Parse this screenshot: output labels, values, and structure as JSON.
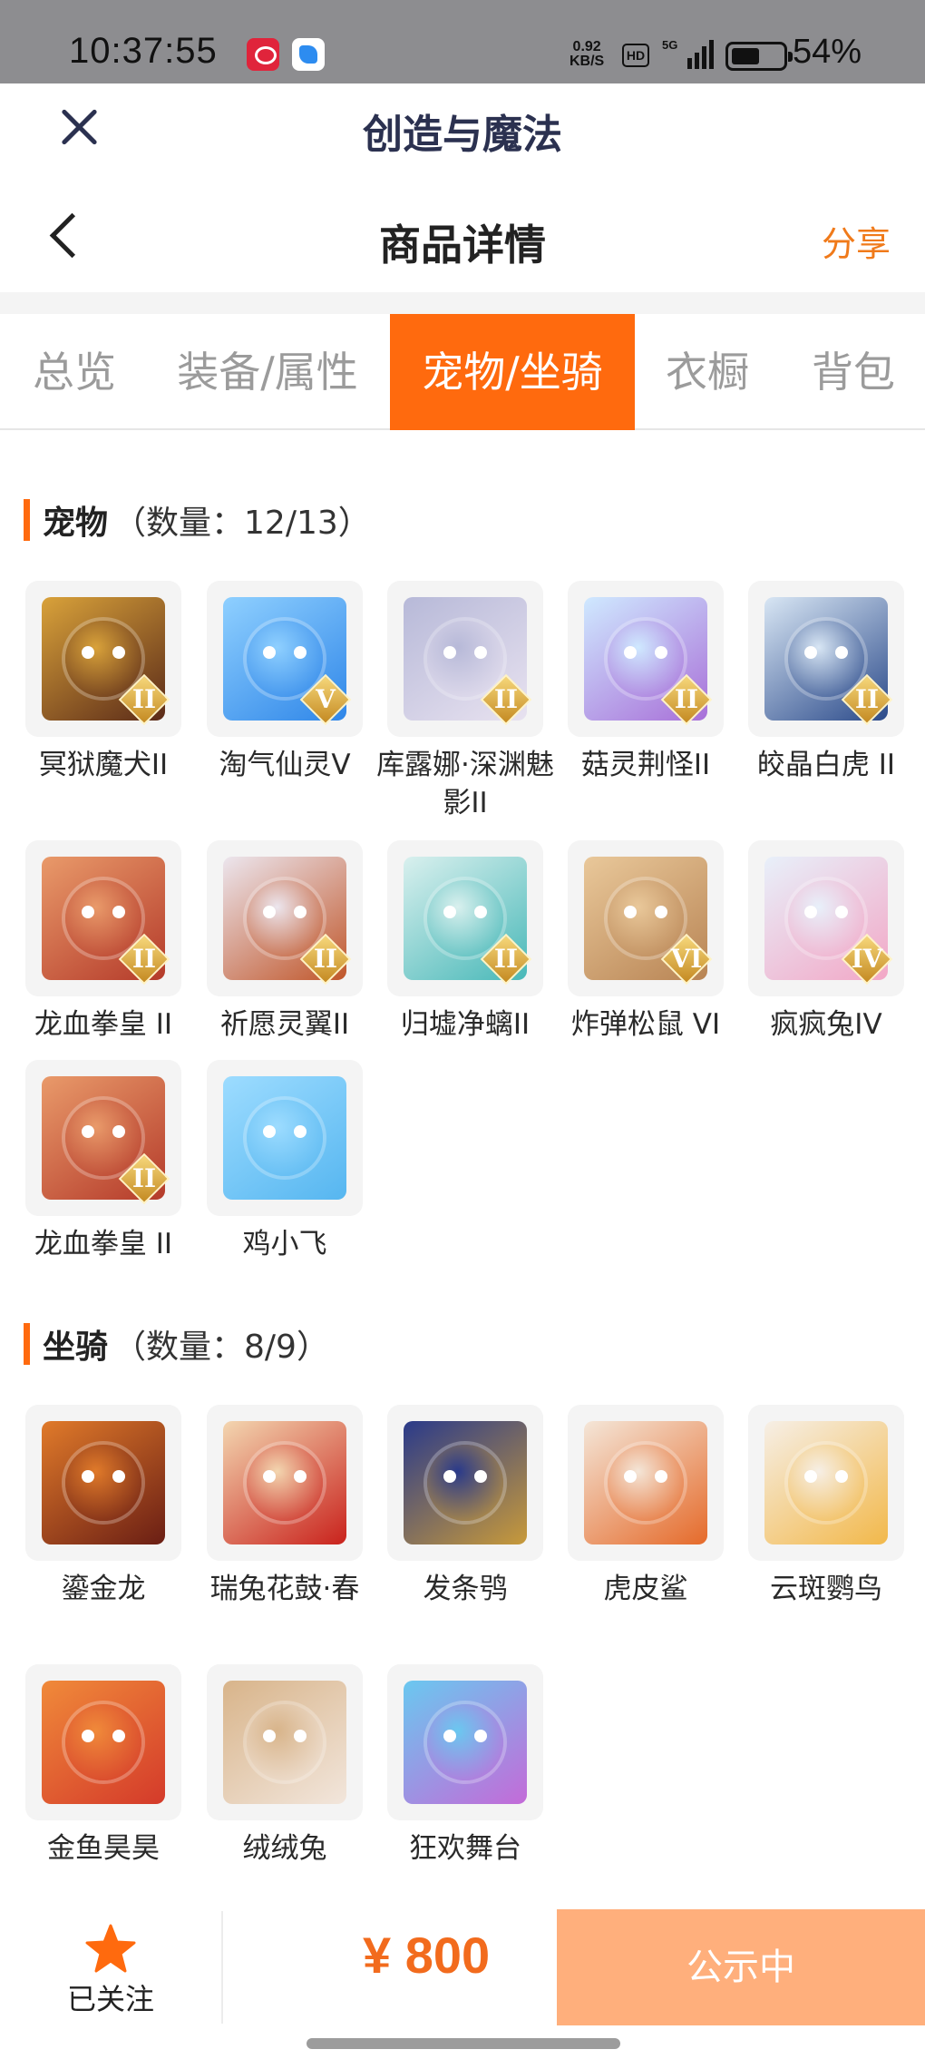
{
  "status_bar": {
    "time": "10:37:55",
    "net_speed": "0.92",
    "net_unit": "KB/S",
    "hd": "HD",
    "network": "5G",
    "battery": "54%"
  },
  "app_bar": {
    "title": "创造与魔法"
  },
  "nav_bar": {
    "title": "商品详情",
    "share": "分享"
  },
  "tabs": [
    {
      "label": "总览",
      "active": false
    },
    {
      "label": "装备/属性",
      "active": false
    },
    {
      "label": "宠物/坐骑",
      "active": true
    },
    {
      "label": "衣橱",
      "active": false
    },
    {
      "label": "背包",
      "active": false
    }
  ],
  "pets": {
    "title": "宠物",
    "count": "（数量：12/13）",
    "items": [
      {
        "name": "冥狱魔犬II",
        "tier": "II",
        "art": [
          "#5a2a18",
          "#d9a23a"
        ]
      },
      {
        "name": "淘气仙灵V",
        "tier": "V",
        "art": [
          "#2f86e8",
          "#8fd0ff"
        ]
      },
      {
        "name": "库露娜·深渊魅影II",
        "tier": "II",
        "art": [
          "#e8e2f0",
          "#b7b9d8"
        ]
      },
      {
        "name": "菇灵荆怪II",
        "tier": "II",
        "art": [
          "#a86fd8",
          "#cfe9ff"
        ]
      },
      {
        "name": "皎晶白虎 II",
        "tier": "II",
        "art": [
          "#2b4a8a",
          "#d8e6f4"
        ]
      },
      {
        "name": "龙血拳皇 II",
        "tier": "II",
        "art": [
          "#b43a2a",
          "#e99a6a"
        ]
      },
      {
        "name": "祈愿灵翼II",
        "tier": "II",
        "art": [
          "#c0562a",
          "#ece6ee"
        ]
      },
      {
        "name": "归墟净螭II",
        "tier": "II",
        "art": [
          "#48b8b8",
          "#d9f0ee"
        ]
      },
      {
        "name": "炸弹松鼠 VI",
        "tier": "VI",
        "art": [
          "#b88454",
          "#e9c89a"
        ]
      },
      {
        "name": "疯疯兔IV",
        "tier": "IV",
        "art": [
          "#f2a7c6",
          "#e8f0fa"
        ]
      },
      {
        "name": "龙血拳皇 II",
        "tier": "II",
        "art": [
          "#b43a2a",
          "#e99a6a"
        ]
      },
      {
        "name": "鸡小飞",
        "tier": "",
        "art": [
          "#56b6f0",
          "#9ddcff"
        ]
      }
    ]
  },
  "mounts": {
    "title": "坐骑",
    "count": "（数量：8/9）",
    "items": [
      {
        "name": "鎏金龙",
        "art": [
          "#6a1e14",
          "#e07a2a"
        ]
      },
      {
        "name": "瑞兔花鼓·春",
        "art": [
          "#c9221c",
          "#f3d6b0"
        ]
      },
      {
        "name": "发条鸮",
        "art": [
          "#c89a3a",
          "#2a3a8a"
        ]
      },
      {
        "name": "虎皮鲨",
        "art": [
          "#e56a2a",
          "#f4e6d8"
        ]
      },
      {
        "name": "云斑鹦鸟",
        "art": [
          "#f2b84a",
          "#f6efe6"
        ]
      },
      {
        "name": "金鱼昊昊",
        "art": [
          "#d43a2a",
          "#f08a3a"
        ]
      },
      {
        "name": "绒绒兔",
        "art": [
          "#f2e6dc",
          "#d8b48a"
        ]
      },
      {
        "name": "狂欢舞台",
        "art": [
          "#c46ad8",
          "#6ac8f0"
        ]
      }
    ]
  },
  "bottom_bar": {
    "follow_label": "已关注",
    "price": "¥ 800",
    "status": "公示中"
  },
  "colors": {
    "accent": "#ff6a0e",
    "price": "#f26b1d",
    "status_btn": "#ffaf7c"
  }
}
